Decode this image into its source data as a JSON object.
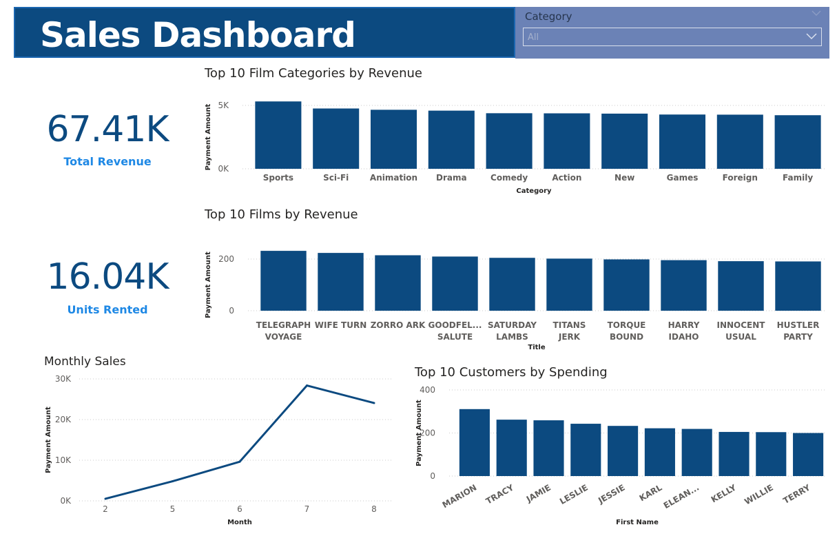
{
  "header": {
    "title": "Sales Dashboard"
  },
  "slicer": {
    "label": "Category",
    "value": "All",
    "icon": "chevron-down-icon"
  },
  "kpis": {
    "revenue": {
      "value": "67.41K",
      "label": "Total Revenue"
    },
    "units": {
      "value": "16.04K",
      "label": "Units Rented"
    }
  },
  "colors": {
    "bar": "#0c4a80",
    "header": "#0c4a80",
    "slicer": "#6b82b6",
    "kpi_label": "#1e88e5",
    "grid": "#c8c8c8"
  },
  "chart_data": [
    {
      "id": "categories",
      "type": "bar",
      "title": "Top 10 Film Categories by Revenue",
      "xlabel": "Category",
      "ylabel": "Payment Amount",
      "categories": [
        "Sports",
        "Sci-Fi",
        "Animation",
        "Drama",
        "Comedy",
        "Action",
        "New",
        "Games",
        "Foreign",
        "Family"
      ],
      "values": [
        5314,
        4757,
        4656,
        4587,
        4384,
        4375,
        4352,
        4281,
        4270,
        4227
      ],
      "ylim": [
        0,
        5000
      ],
      "yticks": [
        "0K",
        "5K"
      ],
      "grid": true
    },
    {
      "id": "films",
      "type": "bar",
      "title": "Top 10 Films by Revenue",
      "xlabel": "Title",
      "ylabel": "Payment Amount",
      "categories": [
        [
          "TELEGRAPH",
          "VOYAGE"
        ],
        [
          "WIFE TURN"
        ],
        [
          "ZORRO ARK"
        ],
        [
          "GOODFEL...",
          "SALUTE"
        ],
        [
          "SATURDAY",
          "LAMBS"
        ],
        [
          "TITANS",
          "JERK"
        ],
        [
          "TORQUE",
          "BOUND"
        ],
        [
          "HARRY",
          "IDAHO"
        ],
        [
          "INNOCENT",
          "USUAL"
        ],
        [
          "HUSTLER",
          "PARTY"
        ]
      ],
      "values": [
        231.73,
        223.69,
        214.69,
        209.69,
        204.72,
        201.71,
        198.72,
        195.7,
        191.74,
        190.78
      ],
      "ylim": [
        0,
        200
      ],
      "yticks": [
        "0",
        "200"
      ],
      "grid": true
    },
    {
      "id": "monthly",
      "type": "line",
      "title": "Monthly Sales",
      "xlabel": "Month",
      "ylabel": "Payment Amount",
      "x": [
        2,
        5,
        6,
        7,
        8
      ],
      "y": [
        514,
        4824,
        9631,
        28373,
        24072
      ],
      "xticks": [
        "2",
        "5",
        "6",
        "7",
        "8"
      ],
      "ylim": [
        0,
        30000
      ],
      "yticks": [
        "0K",
        "10K",
        "20K",
        "30K"
      ],
      "grid": true
    },
    {
      "id": "customers",
      "type": "bar",
      "title": "Top 10 Customers by Spending",
      "xlabel": "First Name",
      "ylabel": "Payment Amount",
      "categories": [
        "MARION",
        "TRACY",
        "JAMIE",
        "LESLIE",
        "JESSIE",
        "KARL",
        "ELEAN...",
        "KELLY",
        "WILLIE",
        "TERRY"
      ],
      "values": [
        311,
        262,
        259,
        243,
        233,
        222,
        219,
        205,
        204,
        200
      ],
      "ylim": [
        0,
        400
      ],
      "yticks": [
        "0",
        "200",
        "400"
      ],
      "grid": true
    }
  ]
}
